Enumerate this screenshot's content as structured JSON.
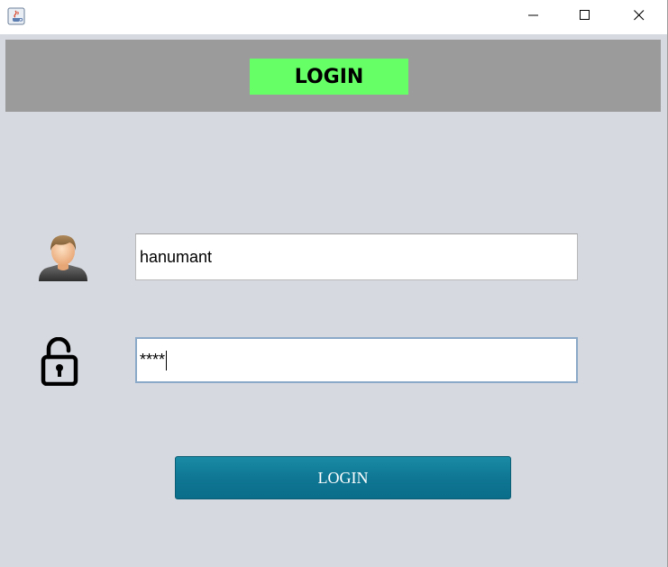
{
  "window": {
    "controls": {
      "minimize_icon": "minimize-icon",
      "maximize_icon": "maximize-icon",
      "close_icon": "close-icon"
    }
  },
  "header": {
    "title": "LOGIN",
    "background_color": "#9b9b9b",
    "title_background_color": "#66ff66"
  },
  "form": {
    "username": {
      "icon": "user-avatar-icon",
      "value": "hanumant"
    },
    "password": {
      "icon": "unlocked-padlock-icon",
      "value": "****"
    },
    "submit_label": "LOGIN",
    "submit_color": "#0e7592"
  },
  "colors": {
    "content_background": "#d6d9e0",
    "focus_border": "#8aa9c8"
  }
}
